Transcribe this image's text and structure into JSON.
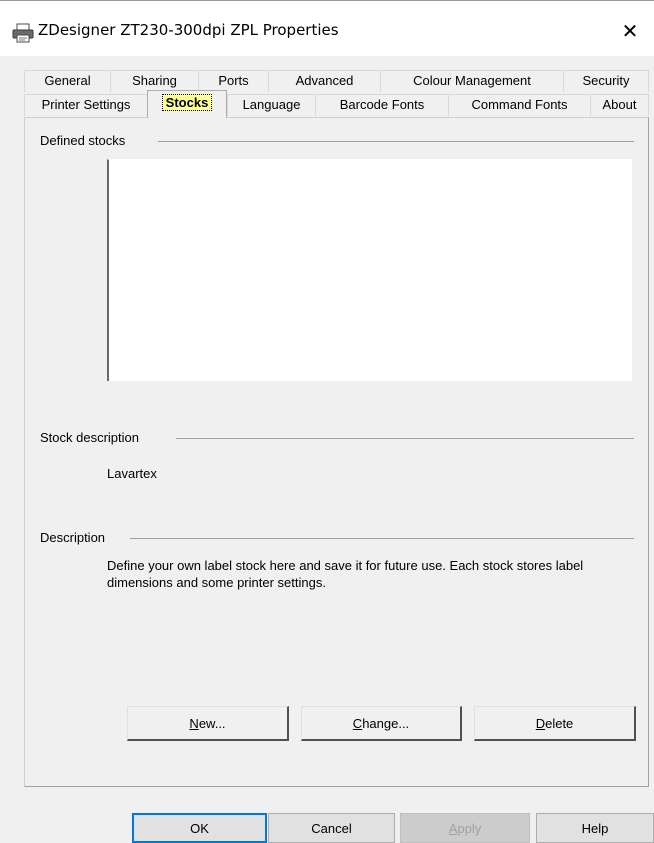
{
  "window": {
    "title": "ZDesigner ZT230-300dpi ZPL Properties",
    "close_glyph": "✕",
    "printer_icon": "printer-icon"
  },
  "tabs": {
    "row1": [
      "General",
      "Sharing",
      "Ports",
      "Advanced",
      "Colour Management",
      "Security"
    ],
    "row2": [
      "Printer Settings",
      "Stocks",
      "Language",
      "Barcode Fonts",
      "Command Fonts",
      "About"
    ],
    "selected": "Stocks"
  },
  "panel": {
    "defined_stocks_label": "Defined stocks",
    "stock_description_label": "Stock description",
    "stock_description_value": "Lavartex",
    "description_label": "Description",
    "description_text": "Define your own label stock here and save it for future use. Each stock stores label dimensions and some printer settings.",
    "buttons": {
      "new_prefix": "N",
      "new_rest": "ew...",
      "change_prefix": "C",
      "change_rest": "hange...",
      "delete_prefix": "D",
      "delete_rest": "elete"
    }
  },
  "footer": {
    "ok": "OK",
    "cancel": "Cancel",
    "apply_prefix": "A",
    "apply_rest": "pply",
    "help": "Help"
  },
  "colors": {
    "selected_tab_highlight": "#ffff99",
    "dialog_background": "#f0f0f0"
  }
}
